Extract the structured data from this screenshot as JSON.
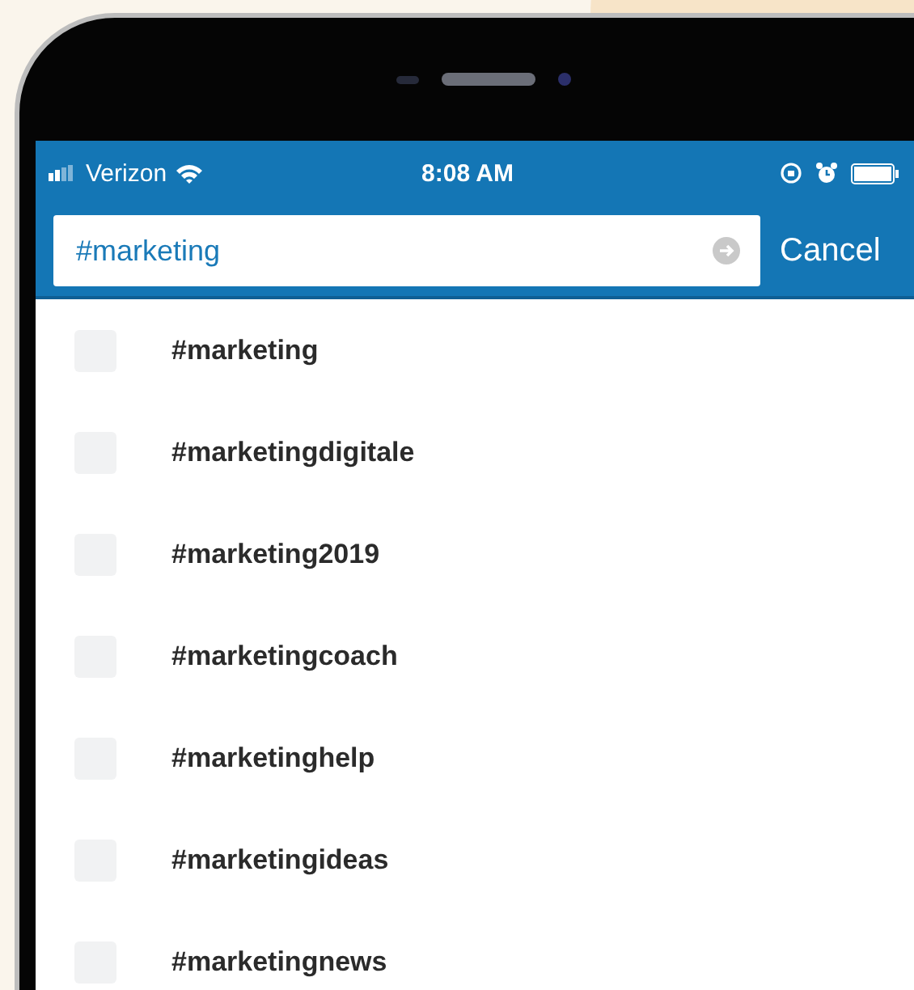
{
  "status_bar": {
    "carrier": "Verizon",
    "time": "8:08 AM"
  },
  "search": {
    "value": "#marketing",
    "cancel": "Cancel"
  },
  "results": [
    {
      "label": "#marketing"
    },
    {
      "label": "#marketingdigitale"
    },
    {
      "label": "#marketing2019"
    },
    {
      "label": "#marketingcoach"
    },
    {
      "label": "#marketinghelp"
    },
    {
      "label": "#marketingideas"
    },
    {
      "label": "#marketingnews"
    }
  ]
}
